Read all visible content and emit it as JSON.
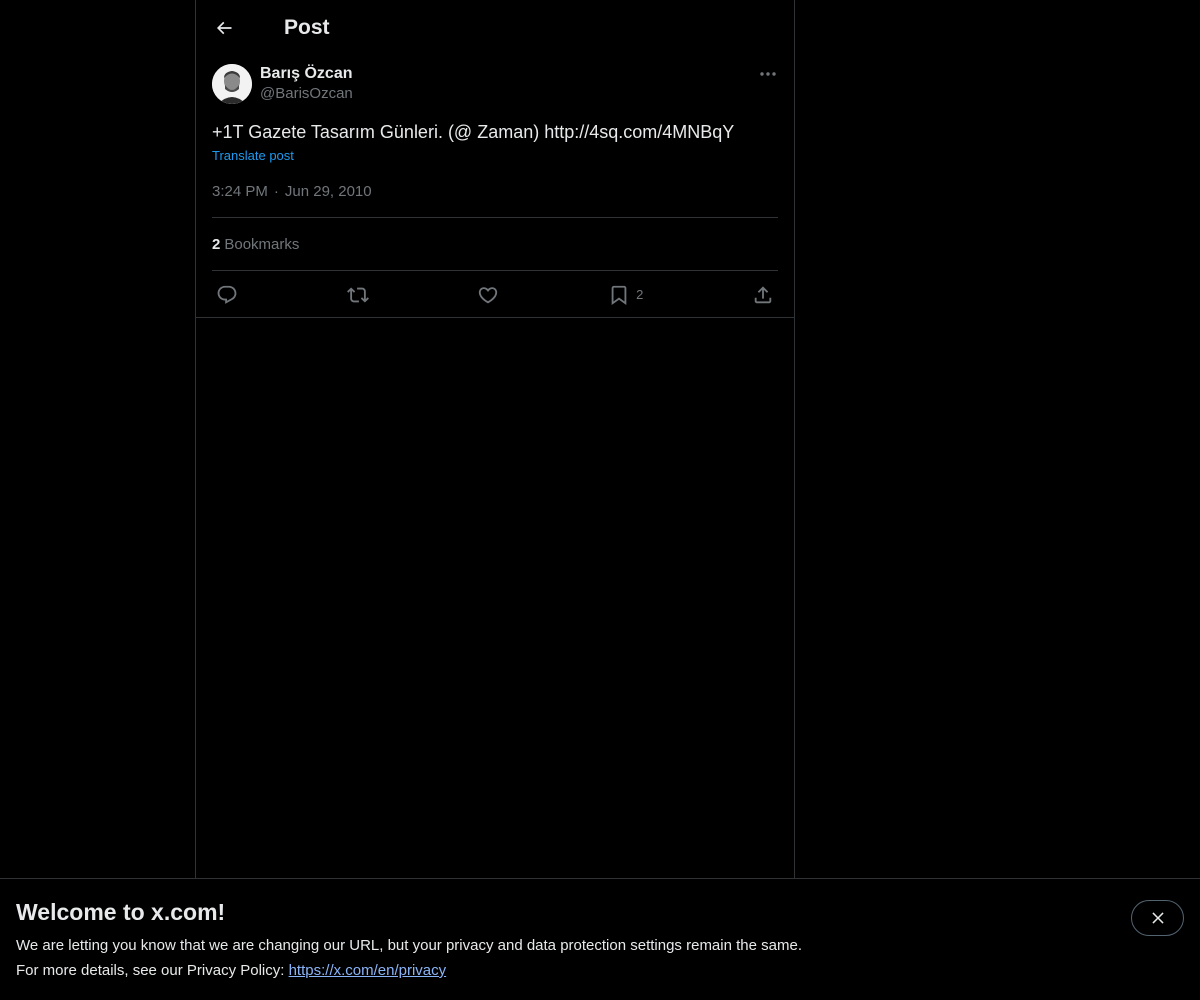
{
  "header": {
    "title": "Post"
  },
  "post": {
    "author_name": "Barış Özcan",
    "author_handle": "@BarisOzcan",
    "text": "+1T Gazete Tasarım Günleri. (@ Zaman) http://4sq.com/4MNBqY",
    "translate_label": "Translate post",
    "time": "3:24 PM",
    "separator": "·",
    "date": "Jun 29, 2010",
    "bookmarks_count": "2",
    "bookmarks_label": "Bookmarks",
    "actions": {
      "reply_icon": "reply-icon",
      "repost_icon": "repost-icon",
      "like_icon": "heart-icon",
      "bookmark_icon": "bookmark-icon",
      "bookmark_count": "2",
      "share_icon": "share-icon"
    }
  },
  "banner": {
    "title": "Welcome to x.com!",
    "line1": "We are letting you know that we are changing our URL, but your privacy and data protection settings remain the same.",
    "line2_prefix": "For more details, see our Privacy Policy: ",
    "link": "https://x.com/en/privacy"
  },
  "colors": {
    "background": "#000000",
    "text": "#e7e9ea",
    "muted": "#71767b",
    "accent": "#1d9bf0",
    "border": "#2f3336"
  }
}
